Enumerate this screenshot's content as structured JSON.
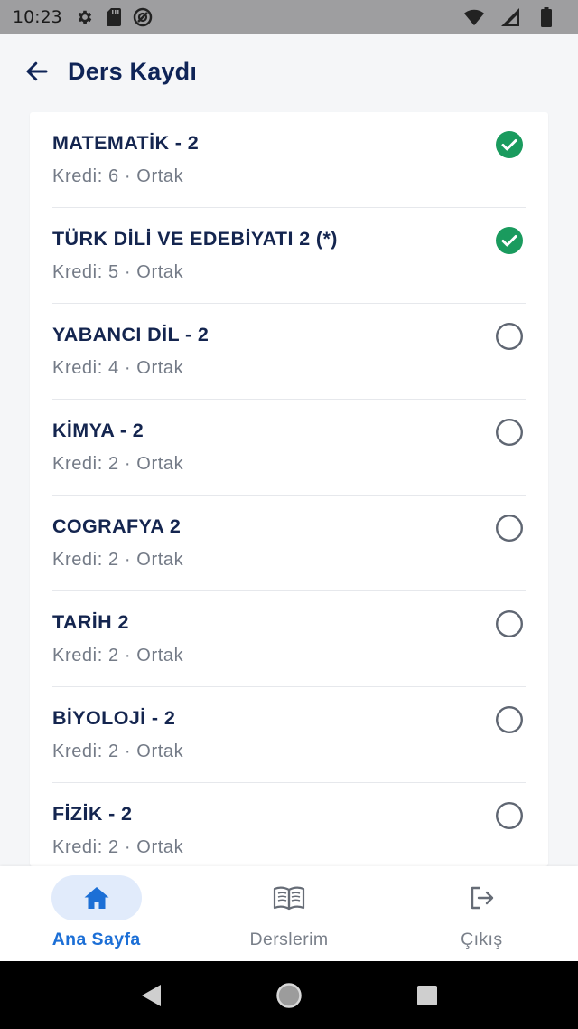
{
  "status_bar": {
    "time": "10:23",
    "icons": [
      "settings-icon",
      "sd-card-icon",
      "no-disturb-icon",
      "wifi-icon",
      "signal-icon",
      "battery-icon"
    ]
  },
  "header": {
    "title": "Ders Kaydı",
    "back_icon": "arrow-left-icon"
  },
  "courses": [
    {
      "name": "MATEMATİK - 2",
      "meta": "Kredi: 6 · Ortak",
      "selected": true
    },
    {
      "name": "TÜRK DİLİ VE EDEBİYATI 2 (*)",
      "meta": "Kredi: 5 · Ortak",
      "selected": true
    },
    {
      "name": "YABANCI DİL - 2",
      "meta": "Kredi: 4 · Ortak",
      "selected": false
    },
    {
      "name": "KİMYA - 2",
      "meta": "Kredi: 2 · Ortak",
      "selected": false
    },
    {
      "name": "COGRAFYA 2",
      "meta": "Kredi: 2 · Ortak",
      "selected": false
    },
    {
      "name": "TARİH 2",
      "meta": "Kredi: 2 · Ortak",
      "selected": false
    },
    {
      "name": "BİYOLOJİ - 2",
      "meta": "Kredi: 2 · Ortak",
      "selected": false
    },
    {
      "name": "FİZİK - 2",
      "meta": "Kredi: 2 · Ortak",
      "selected": false
    }
  ],
  "bottom_nav": {
    "items": [
      {
        "label": "Ana Sayfa",
        "icon": "home-icon",
        "active": true
      },
      {
        "label": "Derslerim",
        "icon": "book-icon",
        "active": false
      },
      {
        "label": "Çıkış",
        "icon": "logout-icon",
        "active": false
      }
    ]
  },
  "colors": {
    "primary": "#1c6fd6",
    "title": "#0f2457",
    "check_green": "#1a9b5e",
    "muted": "#747b87"
  }
}
